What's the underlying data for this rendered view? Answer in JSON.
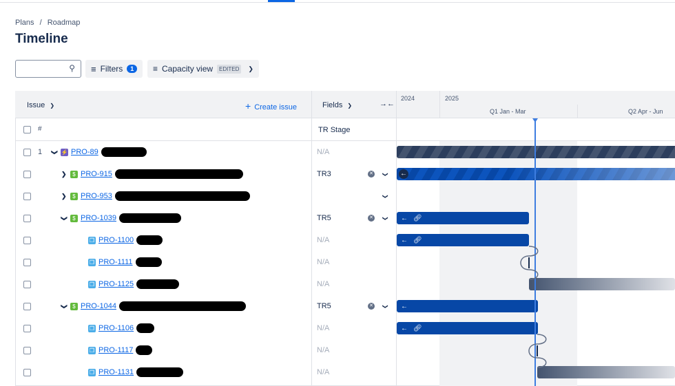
{
  "breadcrumb": {
    "items": [
      "Plans",
      "Roadmap"
    ],
    "sep": "/"
  },
  "page_title": "Timeline",
  "toolbar": {
    "search_placeholder": "",
    "filters_label": "Filters",
    "filters_count": "1",
    "view_label": "Capacity view",
    "view_status": "EDITED"
  },
  "table": {
    "issue_header": "Issue",
    "create_issue": "Create issue",
    "fields_header": "Fields",
    "num_header": "#",
    "field_column": "TR Stage"
  },
  "timeline": {
    "years": [
      "2024",
      "2025"
    ],
    "quarters": [
      "Q1 Jan - Mar",
      "Q2 Apr - Jun"
    ]
  },
  "rows": [
    {
      "num": "1",
      "key": "PRO-89",
      "type": "epic",
      "expand": "down",
      "field": "N/A"
    },
    {
      "num": "",
      "key": "PRO-915",
      "type": "story",
      "expand": "right",
      "field": "TR3"
    },
    {
      "num": "",
      "key": "PRO-953",
      "type": "story",
      "expand": "right",
      "field": ""
    },
    {
      "num": "",
      "key": "PRO-1039",
      "type": "story",
      "expand": "down",
      "field": "TR5"
    },
    {
      "num": "",
      "key": "PRO-1100",
      "type": "subtask",
      "expand": "",
      "field": "N/A"
    },
    {
      "num": "",
      "key": "PRO-1111",
      "type": "subtask",
      "expand": "",
      "field": "N/A"
    },
    {
      "num": "",
      "key": "PRO-1125",
      "type": "subtask",
      "expand": "",
      "field": "N/A"
    },
    {
      "num": "",
      "key": "PRO-1044",
      "type": "story",
      "expand": "down",
      "field": "TR5"
    },
    {
      "num": "",
      "key": "PRO-1106",
      "type": "subtask",
      "expand": "",
      "field": "N/A"
    },
    {
      "num": "",
      "key": "PRO-1117",
      "type": "subtask",
      "expand": "",
      "field": "N/A"
    },
    {
      "num": "",
      "key": "PRO-1131",
      "type": "subtask",
      "expand": "",
      "field": "N/A"
    }
  ],
  "colors": {
    "accent": "#0c66e4",
    "bar": "#0747a6",
    "epic": "#6e5dc6",
    "story": "#63ba3c",
    "subtask": "#4bade8"
  }
}
